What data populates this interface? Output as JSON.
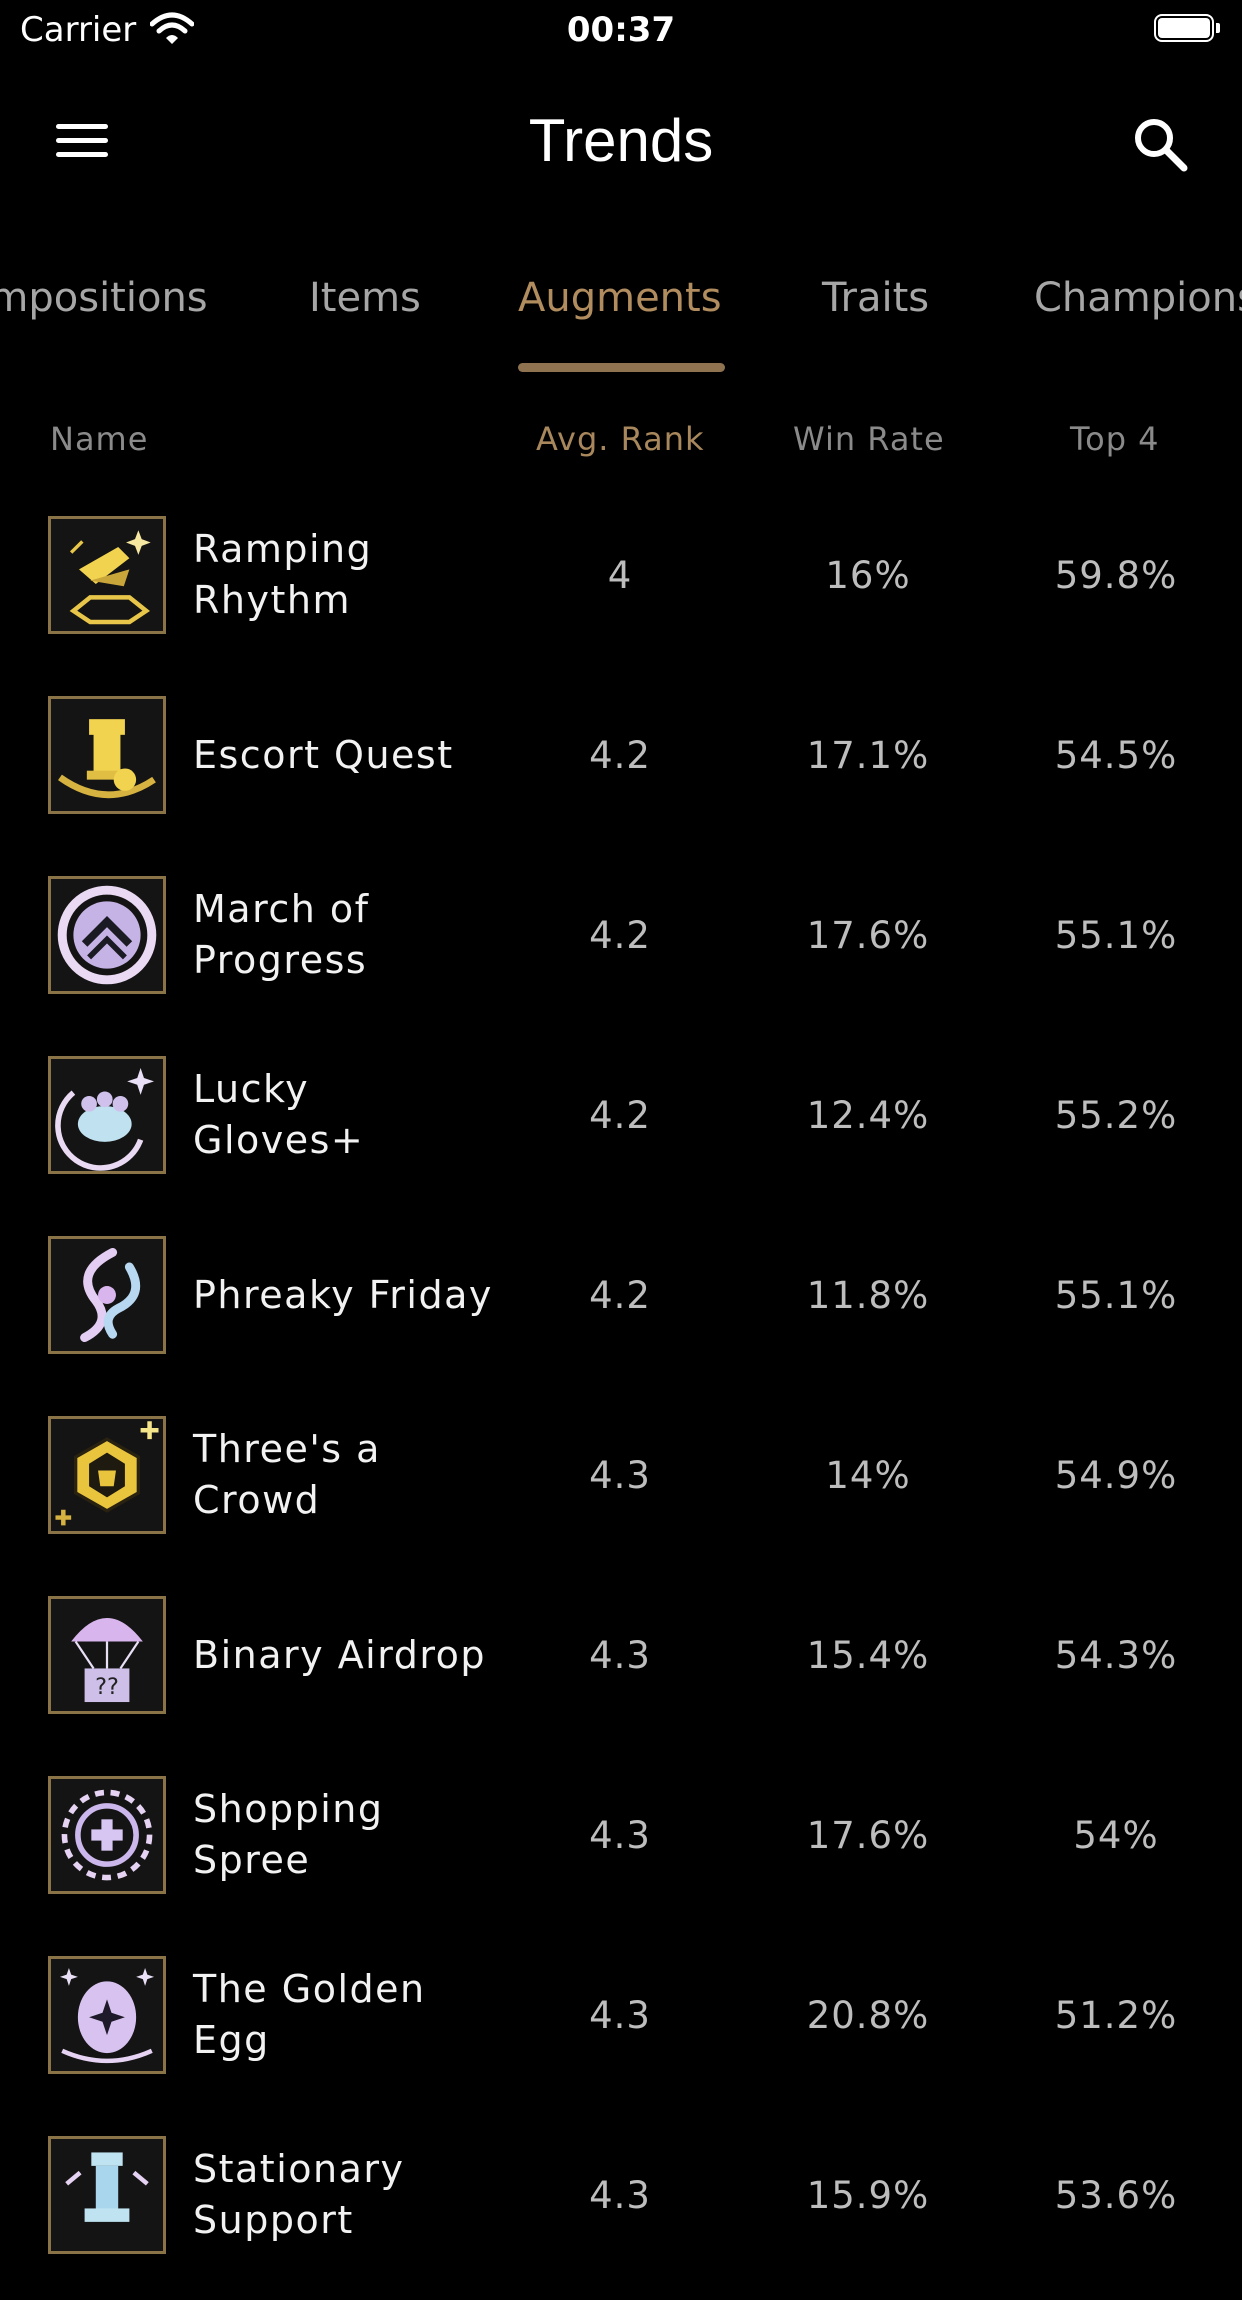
{
  "status_bar": {
    "carrier": "Carrier",
    "time": "00:37"
  },
  "nav": {
    "title": "Trends",
    "menu_icon": "hamburger-icon",
    "search_icon": "search-icon"
  },
  "tabs": [
    {
      "label": "Compositions"
    },
    {
      "label": "Items"
    },
    {
      "label": "Augments",
      "active": true
    },
    {
      "label": "Traits"
    },
    {
      "label": "Champions"
    }
  ],
  "table": {
    "headers": {
      "name": "Name",
      "avg_rank": "Avg. Rank",
      "win_rate": "Win Rate",
      "top4": "Top 4"
    },
    "sorted_by": "avg_rank",
    "rows": [
      {
        "name": "Ramping Rhythm",
        "avg_rank": "4",
        "win_rate": "16%",
        "top4": "59.8%"
      },
      {
        "name": "Escort Quest",
        "avg_rank": "4.2",
        "win_rate": "17.1%",
        "top4": "54.5%"
      },
      {
        "name": "March of Progress",
        "avg_rank": "4.2",
        "win_rate": "17.6%",
        "top4": "55.1%"
      },
      {
        "name": "Lucky Gloves+",
        "avg_rank": "4.2",
        "win_rate": "12.4%",
        "top4": "55.2%"
      },
      {
        "name": "Phreaky Friday",
        "avg_rank": "4.2",
        "win_rate": "11.8%",
        "top4": "55.1%"
      },
      {
        "name": "Three's a Crowd",
        "avg_rank": "4.3",
        "win_rate": "14%",
        "top4": "54.9%"
      },
      {
        "name": "Binary Airdrop",
        "avg_rank": "4.3",
        "win_rate": "15.4%",
        "top4": "54.3%"
      },
      {
        "name": "Shopping Spree",
        "avg_rank": "4.3",
        "win_rate": "17.6%",
        "top4": "54%"
      },
      {
        "name": "The Golden Egg",
        "avg_rank": "4.3",
        "win_rate": "20.8%",
        "top4": "51.2%"
      },
      {
        "name": "Stationary Support",
        "avg_rank": "4.3",
        "win_rate": "15.9%",
        "top4": "53.6%"
      }
    ]
  },
  "colors": {
    "accent": "#b08c5e",
    "background": "#000000",
    "thumb_border": "#8b7348"
  }
}
